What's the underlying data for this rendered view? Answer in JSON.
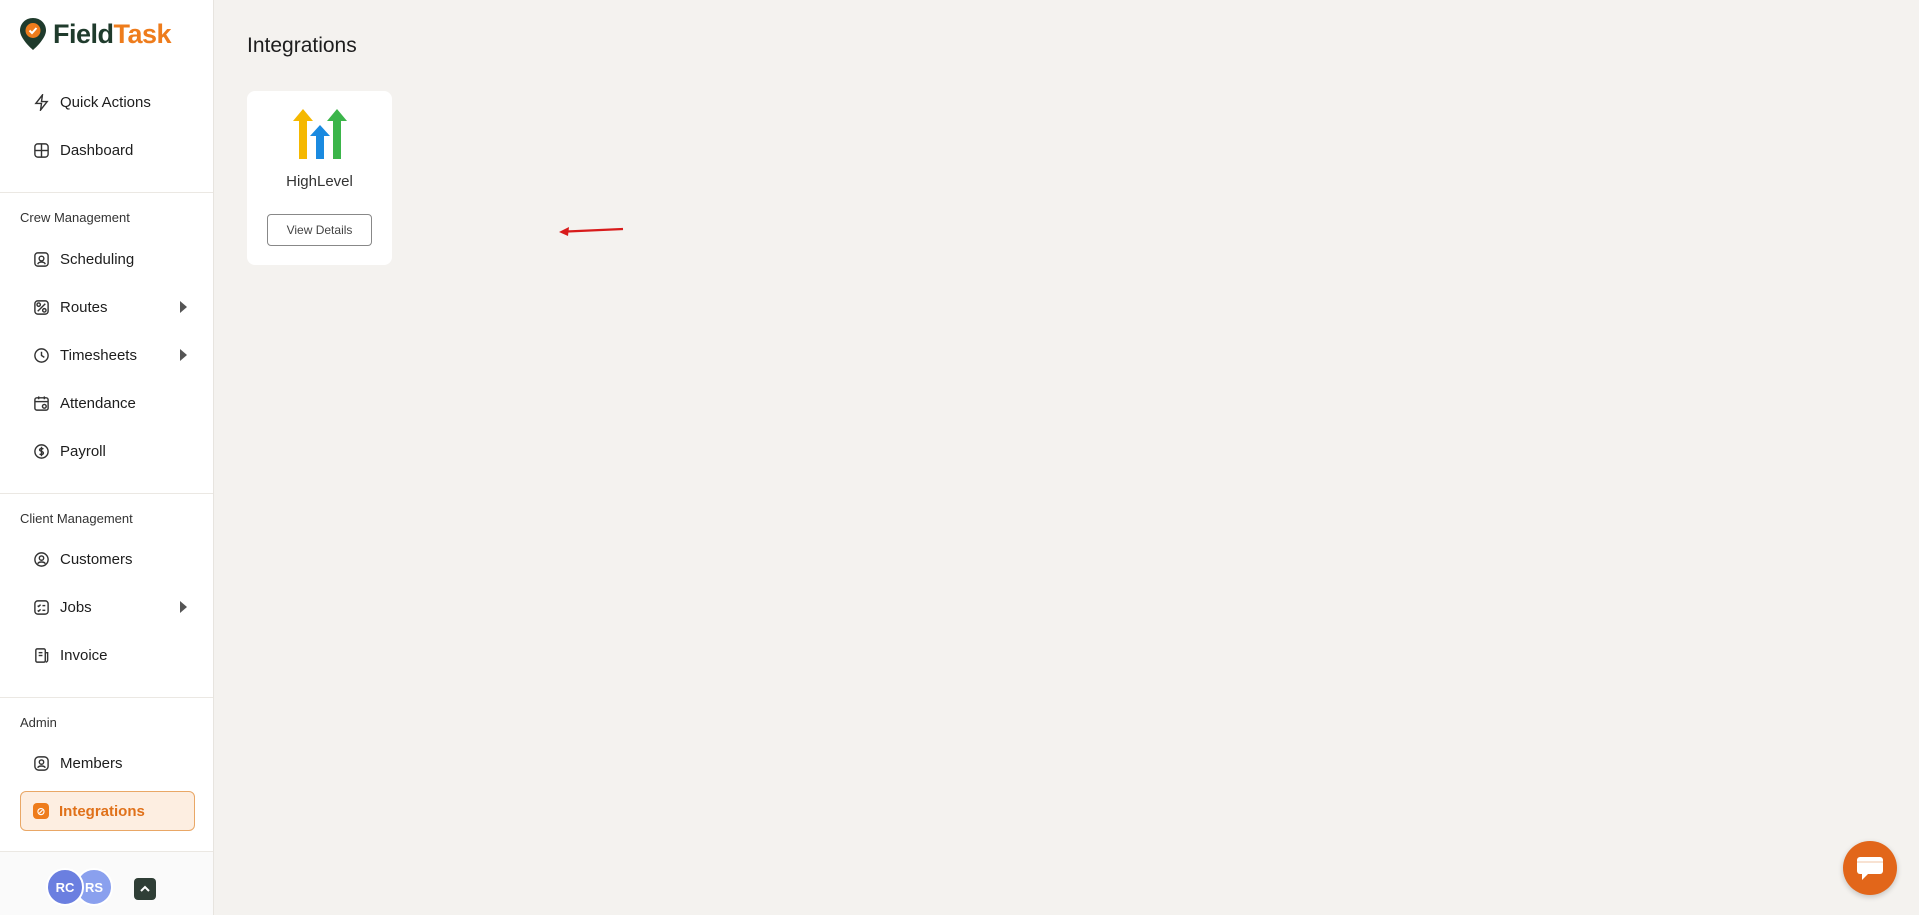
{
  "app": {
    "brand_field": "Field",
    "brand_task": "Task",
    "accent_color": "#ee7c1c"
  },
  "sidebar": {
    "top_items": [
      {
        "label": "Quick Actions",
        "icon": "lightning-icon"
      },
      {
        "label": "Dashboard",
        "icon": "grid-icon"
      }
    ],
    "crew_label": "Crew Management",
    "crew_items": [
      {
        "label": "Scheduling",
        "icon": "calendar-user-icon"
      },
      {
        "label": "Routes",
        "icon": "route-icon",
        "expandable": true
      },
      {
        "label": "Timesheets",
        "icon": "clock-icon",
        "expandable": true
      },
      {
        "label": "Attendance",
        "icon": "calendar-check-icon"
      },
      {
        "label": "Payroll",
        "icon": "dollar-icon"
      }
    ],
    "client_label": "Client Management",
    "client_items": [
      {
        "label": "Customers",
        "icon": "user-circle-icon"
      },
      {
        "label": "Jobs",
        "icon": "checklist-icon",
        "expandable": true
      },
      {
        "label": "Invoice",
        "icon": "receipt-icon"
      }
    ],
    "admin_label": "Admin",
    "admin_items": [
      {
        "label": "Members",
        "icon": "user-square-icon"
      },
      {
        "label": "Integrations",
        "icon": "integrations-icon",
        "active": true
      }
    ],
    "footer": {
      "avatars": [
        "RC",
        "RS"
      ]
    }
  },
  "main": {
    "title": "Integrations",
    "cards": [
      {
        "name": "HighLevel",
        "button_label": "View Details"
      }
    ]
  }
}
